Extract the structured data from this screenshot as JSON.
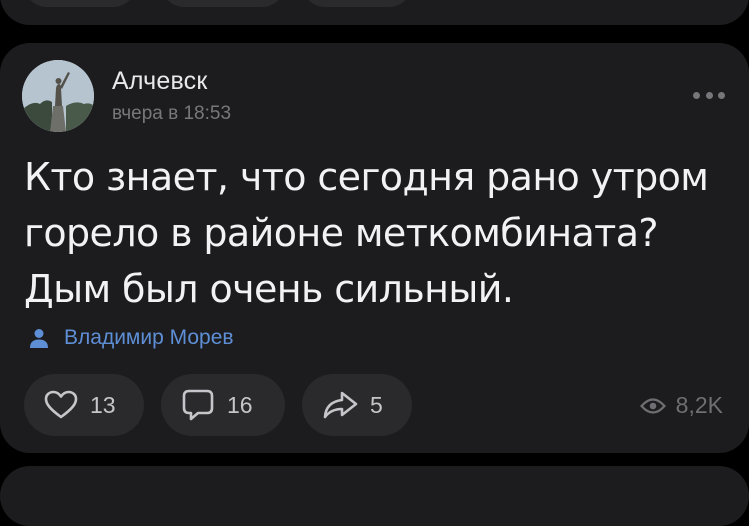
{
  "post": {
    "community_name": "Алчевск",
    "time": "вчера в 18:53",
    "text_lines": [
      "Кто знает, что сегодня рано утром",
      "горело в районе меткомбината?",
      "Дым был очень сильный."
    ],
    "author": "Владимир Морев",
    "likes": "13",
    "comments": "16",
    "shares": "5",
    "views": "8,2K"
  },
  "icons": {
    "avatar": "monument-photo",
    "more": "more-dots-icon",
    "author": "person-icon",
    "like": "heart-icon",
    "comment": "comment-bubble-icon",
    "share": "share-arrow-icon",
    "views": "eye-icon"
  },
  "colors": {
    "background": "#000000",
    "card": "#1c1c1e",
    "button": "#2a2a2d",
    "accent": "#5e8fd6",
    "text": "#f2f2f4",
    "muted": "#77777c"
  }
}
